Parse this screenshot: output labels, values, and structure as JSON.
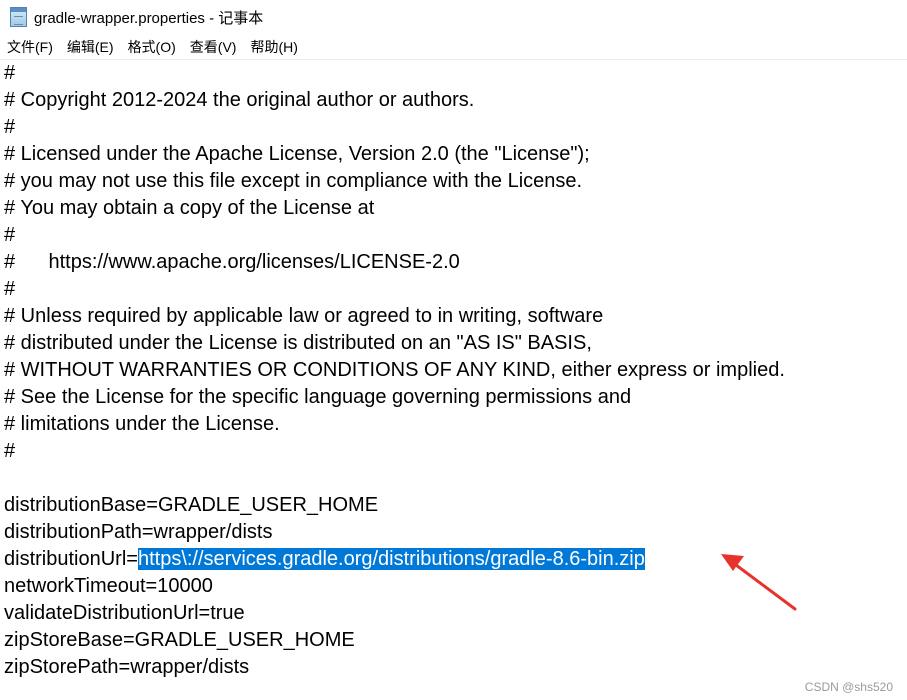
{
  "window": {
    "title": "gradle-wrapper.properties - 记事本",
    "icon": "notepad-icon"
  },
  "menu": [
    "文件(F)",
    "编辑(E)",
    "格式(O)",
    "查看(V)",
    "帮助(H)"
  ],
  "lines": [
    "#",
    "# Copyright 2012-2024 the original author or authors.",
    "#",
    "# Licensed under the Apache License, Version 2.0 (the \"License\");",
    "# you may not use this file except in compliance with the License.",
    "# You may obtain a copy of the License at",
    "#",
    "#      https://www.apache.org/licenses/LICENSE-2.0",
    "#",
    "# Unless required by applicable law or agreed to in writing, software",
    "# distributed under the License is distributed on an \"AS IS\" BASIS,",
    "# WITHOUT WARRANTIES OR CONDITIONS OF ANY KIND, either express or implied.",
    "# See the License for the specific language governing permissions and",
    "# limitations under the License.",
    "#",
    "",
    "distributionBase=GRADLE_USER_HOME",
    "distributionPath=wrapper/dists",
    "distributionUrl=",
    "networkTimeout=10000",
    "validateDistributionUrl=true",
    "zipStoreBase=GRADLE_USER_HOME",
    "zipStorePath=wrapper/dists"
  ],
  "selected_text": "https\\://services.gradle.org/distributions/gradle-8.6-bin.zip",
  "watermark": "CSDN @shs520",
  "colors": {
    "selection": "#0078d7",
    "arrow": "#e8322c"
  }
}
